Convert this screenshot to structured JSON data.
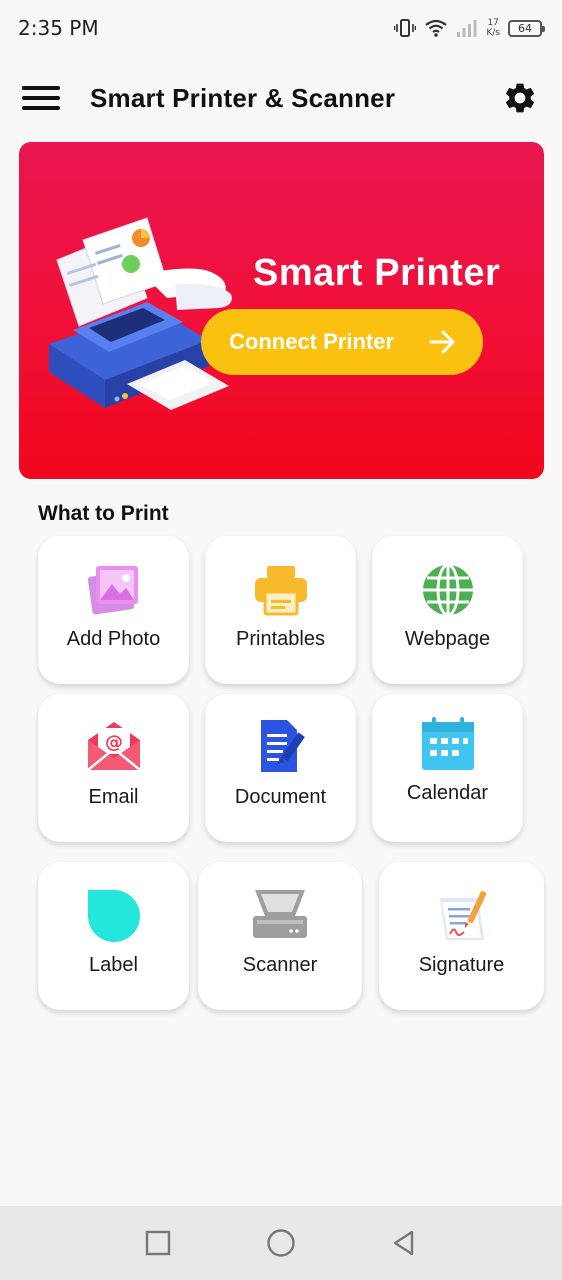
{
  "status_bar": {
    "time": "2:35 PM",
    "net_speed_value": "17",
    "net_speed_unit": "K/s",
    "battery": "64",
    "icons": [
      "vibrate-icon",
      "wifi-icon",
      "signal-icon",
      "battery-icon"
    ]
  },
  "app_bar": {
    "title": "Smart Printer & Scanner",
    "menu_icon": "hamburger-menu-icon",
    "settings_icon": "gear-icon"
  },
  "banner": {
    "title": "Smart Printer",
    "button_label": "Connect Printer",
    "gradient": [
      "#e8164f",
      "#f1071c"
    ],
    "button_color": "#fbc111"
  },
  "section": {
    "title": "What to Print"
  },
  "tiles": [
    {
      "label": "Add Photo",
      "icon": "photo-icon",
      "color": "#e57ce8"
    },
    {
      "label": "Printables",
      "icon": "printer-icon",
      "color": "#f8b92a"
    },
    {
      "label": "Webpage",
      "icon": "globe-icon",
      "color": "#4caf50"
    },
    {
      "label": "Email",
      "icon": "email-icon",
      "color": "#ee3b5b"
    },
    {
      "label": "Document",
      "icon": "document-icon",
      "color": "#2b55e0"
    },
    {
      "label": "Calendar",
      "icon": "calendar-icon",
      "color": "#3fc6f0"
    },
    {
      "label": "Label",
      "icon": "label-icon",
      "color": "#25e6dc"
    },
    {
      "label": "Scanner",
      "icon": "scanner-icon",
      "color": "#9e9e9e"
    },
    {
      "label": "Signature",
      "icon": "signature-icon",
      "color": "#ef5350"
    }
  ],
  "nav_bar": {
    "icons": [
      "recents-square-icon",
      "home-circle-icon",
      "back-triangle-icon"
    ]
  }
}
